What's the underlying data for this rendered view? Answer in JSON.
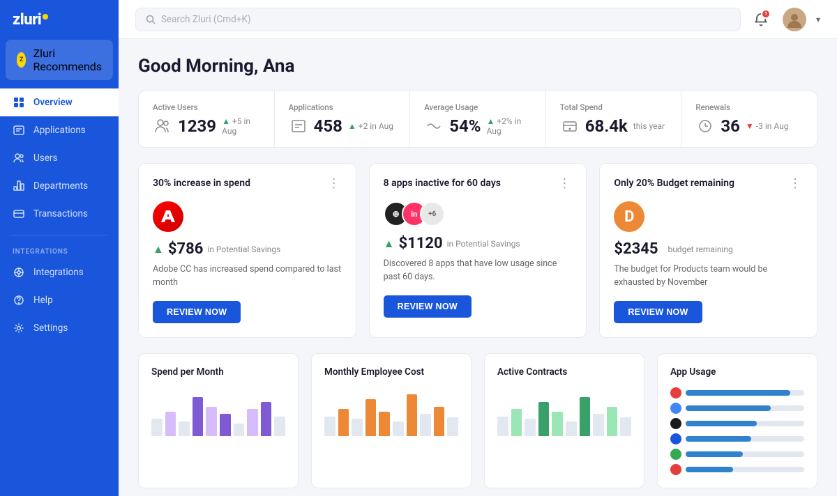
{
  "sidebar": {
    "logo": "zluri",
    "recommend_label": "Zluri Recommends",
    "nav_items": [
      {
        "id": "overview",
        "label": "Overview",
        "active": true
      },
      {
        "id": "applications",
        "label": "Applications",
        "active": false
      },
      {
        "id": "users",
        "label": "Users",
        "active": false
      },
      {
        "id": "departments",
        "label": "Departments",
        "active": false
      },
      {
        "id": "transactions",
        "label": "Transactions",
        "active": false
      }
    ],
    "section_label": "INTEGRATIONS",
    "bottom_items": [
      {
        "id": "integrations",
        "label": "Integrations"
      },
      {
        "id": "help",
        "label": "Help"
      },
      {
        "id": "settings",
        "label": "Settings"
      }
    ]
  },
  "topbar": {
    "search_placeholder": "Search Zluri (Cmd+K)",
    "notification_count": "1"
  },
  "greeting": "Good Morning, Ana",
  "stats": [
    {
      "id": "active-users",
      "label": "Active Users",
      "value": "1239",
      "change": "+5 in Aug",
      "direction": "up"
    },
    {
      "id": "applications",
      "label": "Applications",
      "value": "458",
      "change": "+2 in Aug",
      "direction": "up"
    },
    {
      "id": "average-usage",
      "label": "Average Usage",
      "value": "54%",
      "change": "+2% in Aug",
      "direction": "up"
    },
    {
      "id": "total-spend",
      "label": "Total Spend",
      "value": "68.4k",
      "change": "this year",
      "direction": "neutral"
    },
    {
      "id": "renewals",
      "label": "Renewals",
      "value": "36",
      "change": "-3 in Aug",
      "direction": "down"
    }
  ],
  "insight_cards": [
    {
      "id": "spend-increase",
      "title": "30% increase in spend",
      "app_name": "Adobe CC",
      "app_icon_type": "adobe",
      "savings_amount": "$786",
      "savings_label": "in Potential Savings",
      "description": "Adobe CC has increased spend compared to last month",
      "button_label": "REVIEW NOW"
    },
    {
      "id": "inactive-apps",
      "title": "8 apps inactive for 60 days",
      "app_icon_type": "stack",
      "savings_amount": "$1120",
      "savings_label": "in Potential Savings",
      "description": "Discovered 8 apps that have low usage since past 60 days.",
      "button_label": "REVIEW NOW"
    },
    {
      "id": "budget-remaining",
      "title": "Only 20% Budget remaining",
      "app_icon_type": "budget",
      "budget_amount": "$2345",
      "budget_label": "budget remaining",
      "description": "The budget for Products team would be exhausted by November",
      "button_label": "REVIEW NOW"
    }
  ],
  "bottom_cards": [
    {
      "id": "spend-per-month",
      "title": "Spend per Month",
      "chart_type": "bar-purple"
    },
    {
      "id": "monthly-employee-cost",
      "title": "Monthly Employee Cost",
      "chart_type": "bar-orange"
    },
    {
      "id": "active-contracts",
      "title": "Active Contracts",
      "chart_type": "bar-green"
    },
    {
      "id": "app-usage",
      "title": "App Usage",
      "chart_type": "horizontal-bars"
    }
  ],
  "app_usage_items": [
    {
      "color": "#e53e3e",
      "width": "88%"
    },
    {
      "color": "#4285f4",
      "width": "72%"
    },
    {
      "color": "#1a1a1a",
      "width": "60%"
    },
    {
      "color": "#1a56db",
      "width": "55%"
    },
    {
      "color": "#34a853",
      "width": "48%"
    },
    {
      "color": "#e53e3e",
      "width": "40%"
    }
  ]
}
